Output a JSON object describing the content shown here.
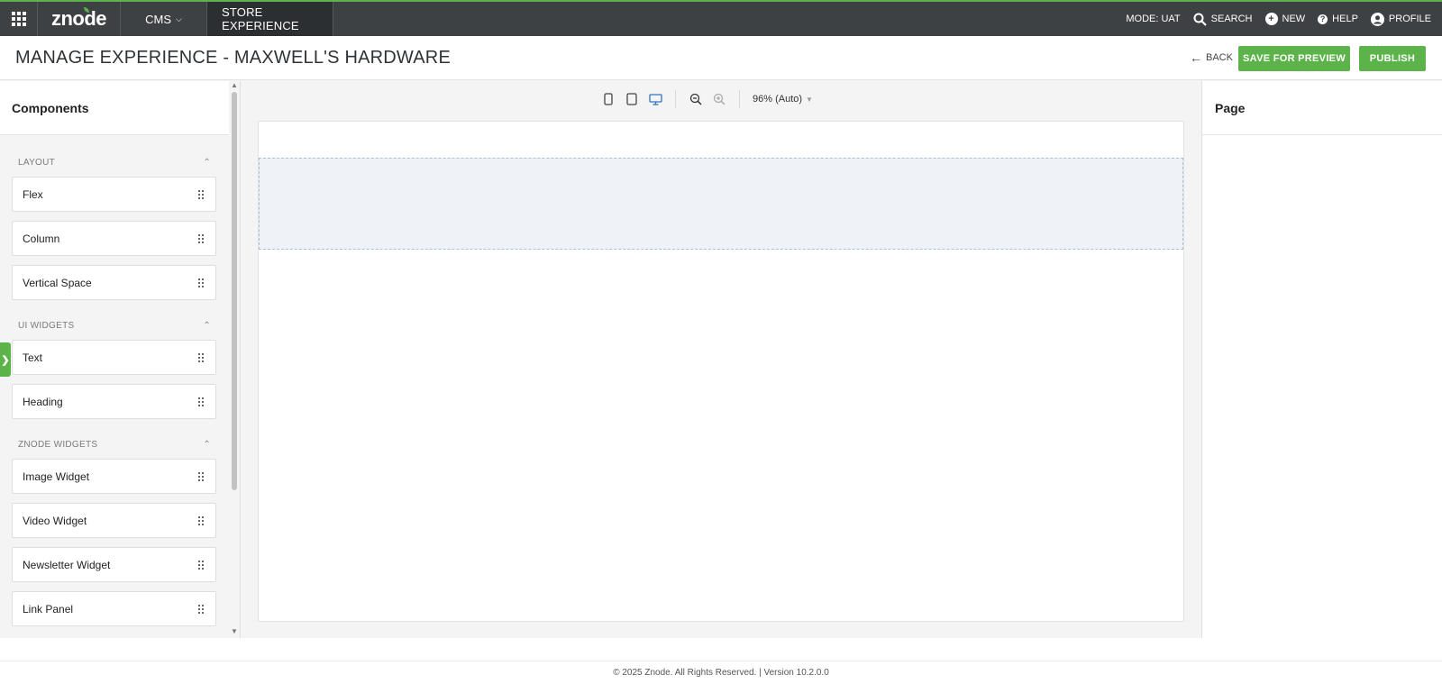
{
  "topbar": {
    "logo": "znode",
    "nav_cms": "CMS",
    "nav_store": "STORE EXPERIENCE",
    "mode": "MODE: UAT",
    "search": "SEARCH",
    "new": "NEW",
    "help": "HELP",
    "profile": "PROFILE",
    "accent_color": "#5cb34a"
  },
  "header": {
    "title": "MANAGE EXPERIENCE - MAXWELL'S HARDWARE",
    "back": "BACK",
    "save_for_preview": "SAVE FOR PREVIEW",
    "publish": "PUBLISH"
  },
  "components": {
    "title": "Components",
    "sections": [
      {
        "label": "LAYOUT",
        "items": [
          "Flex",
          "Column",
          "Vertical Space"
        ]
      },
      {
        "label": "UI WIDGETS",
        "items": [
          "Text",
          "Heading"
        ]
      },
      {
        "label": "ZNODE WIDGETS",
        "items": [
          "Image Widget",
          "Video Widget",
          "Newsletter Widget",
          "Link Panel"
        ]
      }
    ]
  },
  "canvas": {
    "zoom": "96% (Auto)",
    "active_device": "desktop"
  },
  "right_panel": {
    "title": "Page"
  },
  "footer": {
    "text": "© 2025 Znode. All Rights Reserved. | Version 10.2.0.0"
  }
}
